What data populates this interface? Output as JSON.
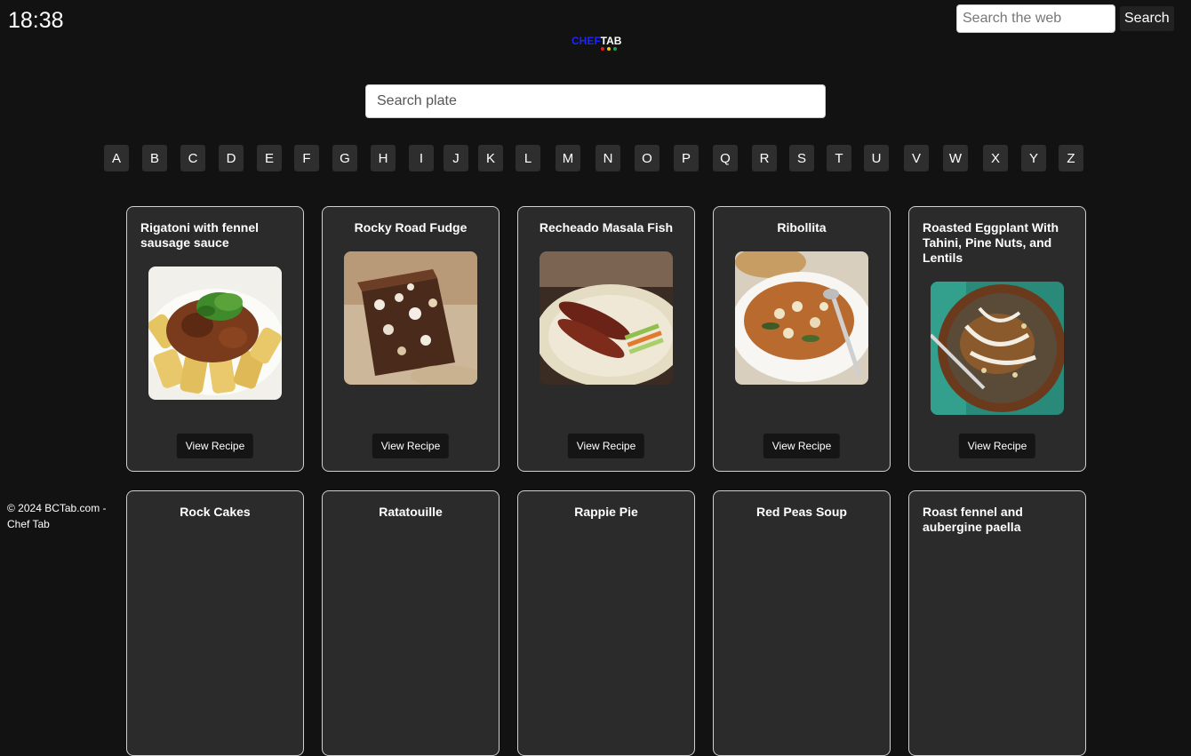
{
  "header": {
    "clock": "18:38",
    "web_search_placeholder": "Search the web",
    "web_search_button": "Search"
  },
  "logo": {
    "part1": "CHEF",
    "part2": "TAB",
    "dot_colors": [
      "#e11d1d",
      "#f5c400",
      "#1fa34a"
    ]
  },
  "plate_search": {
    "placeholder": "Search plate"
  },
  "letters": [
    "A",
    "B",
    "C",
    "D",
    "E",
    "F",
    "G",
    "H",
    "I",
    "J",
    "K",
    "L",
    "M",
    "N",
    "O",
    "P",
    "Q",
    "R",
    "S",
    "T",
    "U",
    "V",
    "W",
    "X",
    "Y",
    "Z"
  ],
  "recipes": [
    {
      "title": "Rigatoni with fennel sausage sauce",
      "button": "View Recipe"
    },
    {
      "title": "Rocky Road Fudge",
      "button": "View Recipe"
    },
    {
      "title": "Recheado Masala Fish",
      "button": "View Recipe"
    },
    {
      "title": "Ribollita",
      "button": "View Recipe"
    },
    {
      "title": "Roasted Eggplant With Tahini, Pine Nuts, and Lentils",
      "button": "View Recipe"
    },
    {
      "title": "Rock Cakes"
    },
    {
      "title": "Ratatouille"
    },
    {
      "title": "Rappie Pie"
    },
    {
      "title": "Red Peas Soup"
    },
    {
      "title": "Roast fennel and aubergine paella"
    }
  ],
  "footer": {
    "text": "© 2024 BCTab.com - Chef Tab"
  }
}
